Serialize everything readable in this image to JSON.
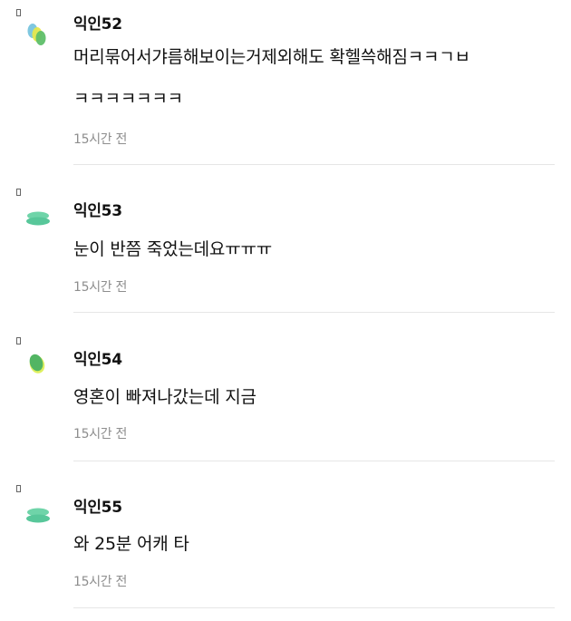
{
  "comments": [
    {
      "author": "익인52",
      "lines": [
        "머리묶어서갸름해보이는거제외해도 확헬쓱해짐ㅋㅋㄱㅂ",
        "ㅋㅋㅋㅋㅋㅋㅋ"
      ],
      "time": "15시간 전"
    },
    {
      "author": "익인53",
      "lines": [
        "눈이 반쯤 죽었는데요ㅠㅠㅠ"
      ],
      "time": "15시간 전"
    },
    {
      "author": "익인54",
      "lines": [
        "영혼이 빠져나갔는데 지금"
      ],
      "time": "15시간 전"
    },
    {
      "author": "익인55",
      "lines": [
        "와 25분 어캐 타"
      ],
      "time": "15시간 전"
    }
  ]
}
